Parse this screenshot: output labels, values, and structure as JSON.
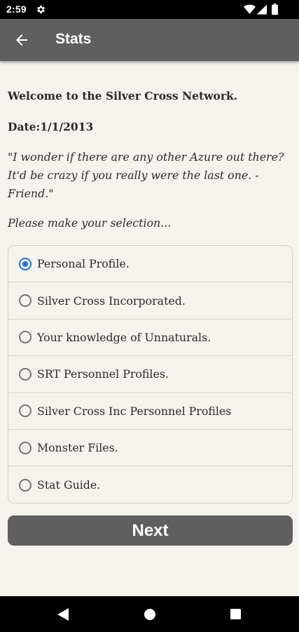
{
  "status_bar": {
    "time": "2:59",
    "icons": [
      "gear-icon",
      "wifi-icon",
      "cell-signal-icon",
      "battery-icon"
    ]
  },
  "app_bar": {
    "title": "Stats",
    "back_icon": "back-arrow-icon"
  },
  "content": {
    "welcome": "Welcome to the Silver Cross Network.",
    "date": "Date:1/1/2013",
    "quote": "\"I wonder if there are any other Azure out there? It'd be crazy if you really were the last one. -Friend.\"",
    "prompt": "Please make your selection..."
  },
  "options": [
    {
      "label": "Personal Profile.",
      "checked": true
    },
    {
      "label": "Silver Cross Incorporated.",
      "checked": false
    },
    {
      "label": "Your knowledge of Unnaturals.",
      "checked": false
    },
    {
      "label": "SRT Personnel Profiles.",
      "checked": false
    },
    {
      "label": "Silver Cross Inc Personnel Profiles",
      "checked": false
    },
    {
      "label": "Monster Files.",
      "checked": false
    },
    {
      "label": "Stat Guide.",
      "checked": false
    }
  ],
  "next_button": {
    "label": "Next"
  },
  "nav_bar": {
    "icons": [
      "nav-back-icon",
      "nav-home-icon",
      "nav-recents-icon"
    ]
  },
  "colors": {
    "app_bar": "#5f5f5f",
    "background": "#f6f3ef",
    "radio_selected": "#1a73e8"
  }
}
